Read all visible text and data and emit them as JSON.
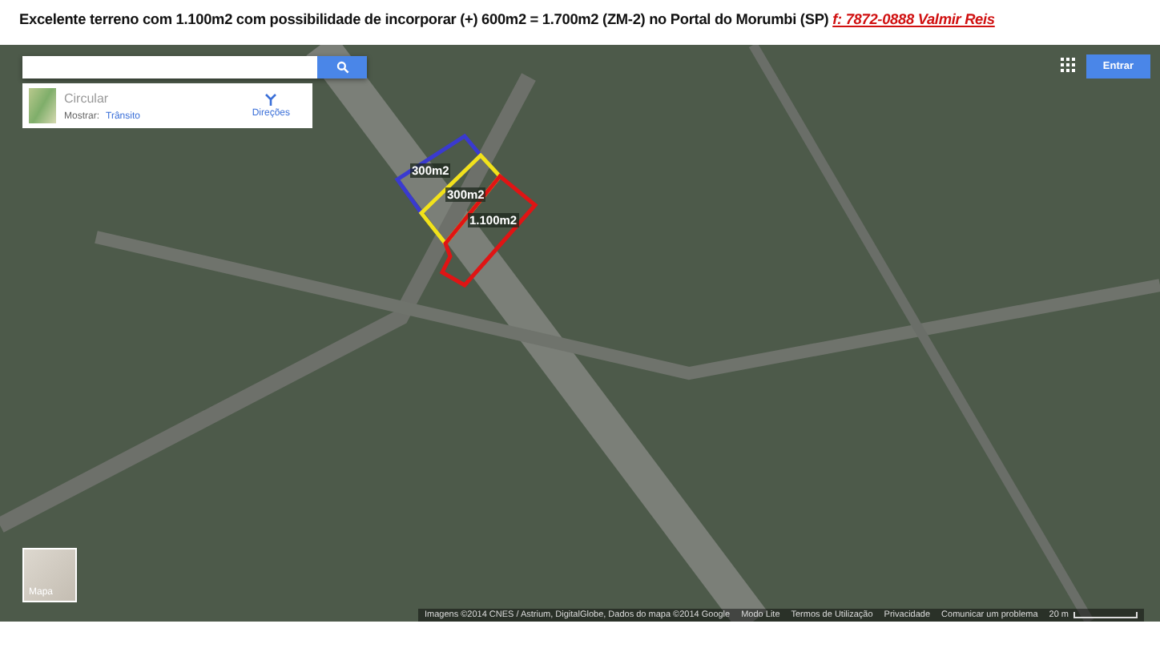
{
  "headline": {
    "text": "Excelente terreno com 1.100m2 com possibilidade de incorporar (+) 600m2 = 1.700m2 (ZM-2) no Portal do Morumbi (SP)",
    "contact": "f: 7872-0888 Valmir Reis"
  },
  "map": {
    "place_card": {
      "title": "Circular",
      "show_label": "Mostrar:",
      "traffic_link": "Trânsito",
      "directions": "Direções"
    },
    "sign_in": "Entrar",
    "plots": [
      {
        "label": "300m2",
        "color": "#3a3ad0"
      },
      {
        "label": "300m2",
        "color": "#f2e21a"
      },
      {
        "label": "1.100m2",
        "color": "#e01414"
      }
    ],
    "map_type": "Mapa",
    "attribution": [
      "Imagens ©2014 CNES / Astrium, DigitalGlobe, Dados do mapa ©2014 Google",
      "Modo Lite",
      "Termos de Utilização",
      "Privacidade",
      "Comunicar um problema"
    ],
    "scale": "20 m"
  }
}
